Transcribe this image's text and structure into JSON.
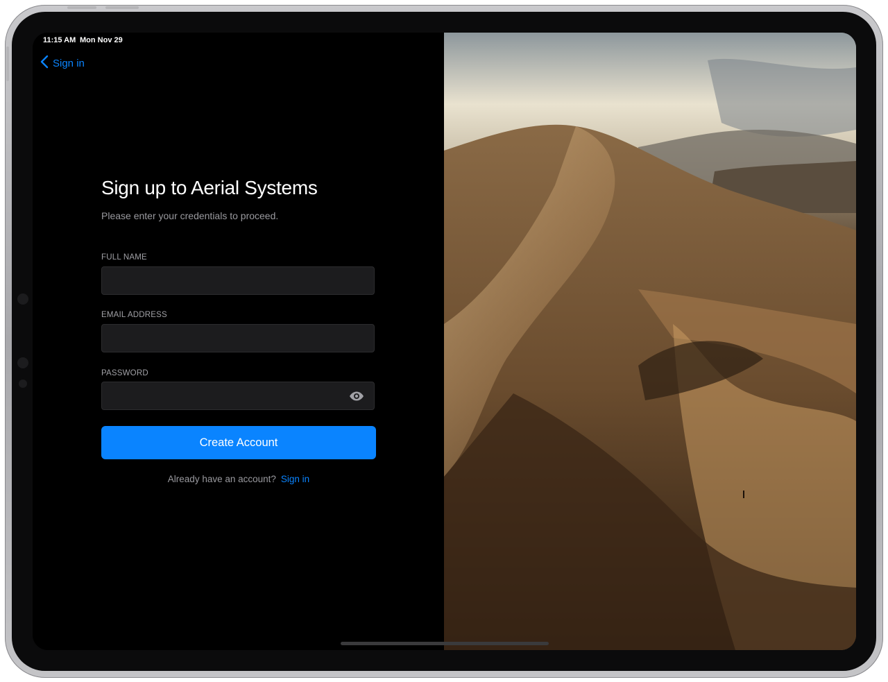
{
  "status_bar": {
    "time": "11:15 AM",
    "date": "Mon Nov 29"
  },
  "nav": {
    "back_label": "Sign in",
    "back_icon": "chevron-left-icon"
  },
  "form": {
    "title": "Sign up to Aerial Systems",
    "subtitle": "Please enter your credentials to proceed.",
    "fields": [
      {
        "label": "FULL NAME",
        "value": "",
        "type": "text"
      },
      {
        "label": "EMAIL ADDRESS",
        "value": "",
        "type": "email"
      },
      {
        "label": "PASSWORD",
        "value": "",
        "type": "password",
        "toggle_icon": "eye-icon"
      }
    ],
    "submit_label": "Create Account",
    "footer_text": "Already have an account?",
    "footer_link": "Sign in"
  },
  "hero": {
    "image": "desert-dunes-photo"
  },
  "colors": {
    "accent": "#0a84ff",
    "background": "#000000",
    "field": "#1c1c1e"
  }
}
